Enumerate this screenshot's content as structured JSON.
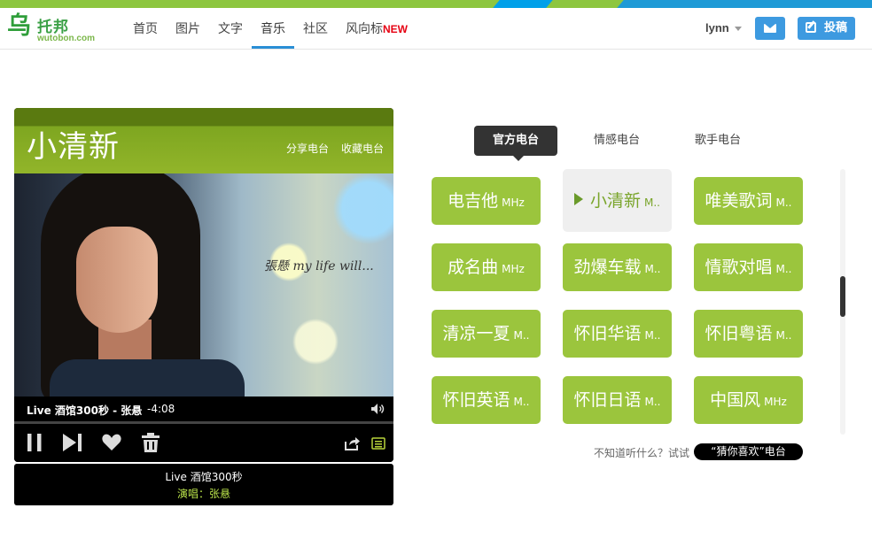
{
  "brand": {
    "logo_mark": "乌",
    "logo_cn": "托邦",
    "logo_en": "wutobon.com"
  },
  "nav": {
    "items": [
      {
        "label": "首页"
      },
      {
        "label": "图片"
      },
      {
        "label": "文字"
      },
      {
        "label": "音乐"
      },
      {
        "label": "社区"
      },
      {
        "label": "风向标"
      }
    ],
    "active_index": 3,
    "new_badge": "NEW"
  },
  "user": {
    "name": "lynn"
  },
  "header_buttons": {
    "mail_icon": "envelope-icon",
    "post_label": "投稿",
    "post_icon": "edit-icon"
  },
  "player": {
    "station_title": "小清新",
    "share_label": "分享电台",
    "collect_label": "收藏电台",
    "cover_caption": "張懸  my life will...",
    "song_line": "Live 酒馆300秒 - 张悬",
    "time_remaining": "-4:08",
    "progress": 0.0,
    "controls": [
      "pause-icon",
      "next-icon",
      "heart-icon",
      "trash-icon",
      "share-icon",
      "list-icon"
    ]
  },
  "now_playing": {
    "title": "Live 酒馆300秒",
    "artist_line": "演唱：张悬"
  },
  "tabs": [
    {
      "label": "官方电台"
    },
    {
      "label": "情感电台"
    },
    {
      "label": "歌手电台"
    }
  ],
  "stations": [
    {
      "name": "电吉他",
      "suffix": "MHz"
    },
    {
      "name": "小清新",
      "suffix": "M.."
    },
    {
      "name": "唯美歌词",
      "suffix": "M.."
    },
    {
      "name": "成名曲",
      "suffix": "MHz"
    },
    {
      "name": "劲爆车载",
      "suffix": "M.."
    },
    {
      "name": "情歌对唱",
      "suffix": "M.."
    },
    {
      "name": "清凉一夏",
      "suffix": "M.."
    },
    {
      "name": "怀旧华语",
      "suffix": "M.."
    },
    {
      "name": "怀旧粤语",
      "suffix": "M.."
    },
    {
      "name": "怀旧英语",
      "suffix": "M.."
    },
    {
      "name": "怀旧日语",
      "suffix": "M.."
    },
    {
      "name": "中国风",
      "suffix": "MHz"
    }
  ],
  "active_station_index": 1,
  "hint": {
    "text": "不知道听什么？试试",
    "button_label": "“猜你喜欢”电台"
  },
  "colors": {
    "accent_green": "#9bc53d",
    "nav_blue": "#2a8fd6",
    "button_blue": "#3d9ae0"
  }
}
